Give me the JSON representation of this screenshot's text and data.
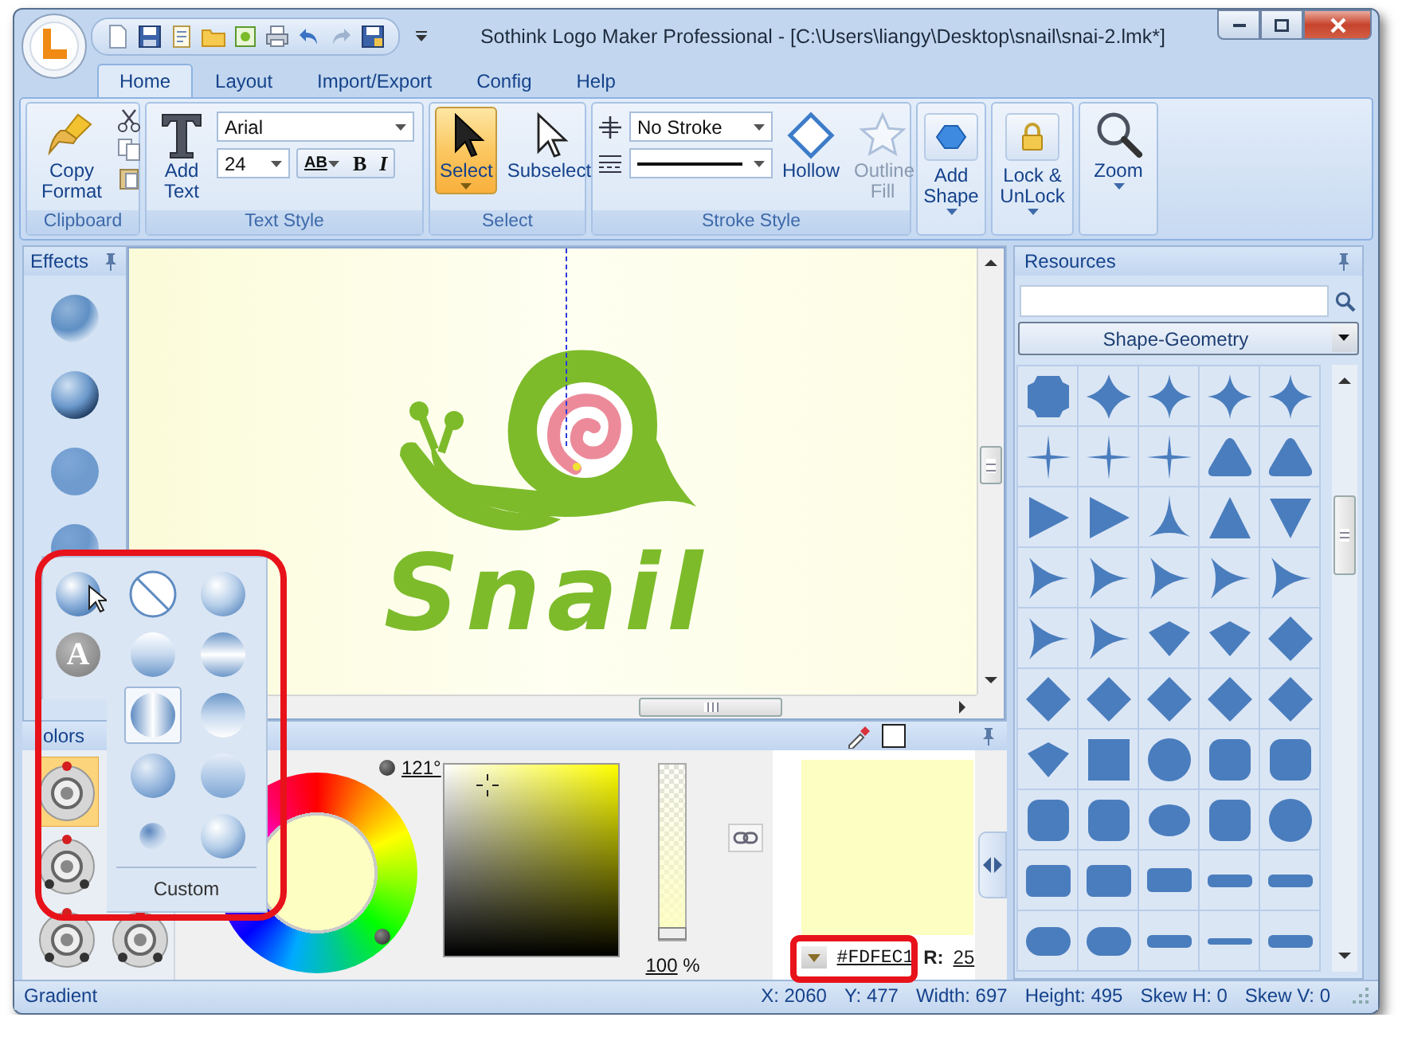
{
  "window": {
    "title": "Sothink Logo Maker Professional - [C:\\Users\\liangy\\Desktop\\snail\\snai-2.lmk*]"
  },
  "tabs": [
    {
      "label": "Home",
      "selected": true
    },
    {
      "label": "Layout",
      "selected": false
    },
    {
      "label": "Import/Export",
      "selected": false
    },
    {
      "label": "Config",
      "selected": false
    },
    {
      "label": "Help",
      "selected": false
    }
  ],
  "ribbon": {
    "clipboard": {
      "label": "Clipboard",
      "copy_format": "Copy Format"
    },
    "text_style": {
      "label": "Text Style",
      "add_text": "Add Text",
      "font": "Arial",
      "size": "24",
      "spacing": "AB",
      "bold": "B",
      "italic": "I"
    },
    "select": {
      "label": "Select",
      "tools": [
        {
          "label": "Select",
          "selected": true
        },
        {
          "label": "Subselect",
          "selected": false
        }
      ]
    },
    "stroke_style": {
      "label": "Stroke Style",
      "stroke": "No Stroke",
      "tools": [
        {
          "label": "Hollow",
          "disabled": false
        },
        {
          "label": "Outline Fill",
          "disabled": true
        }
      ]
    },
    "add_shape": "Add Shape",
    "lock": "Lock & UnLock",
    "zoom": "Zoom"
  },
  "effects": {
    "title": "Effects",
    "items": [
      {
        "kind": "bevel"
      },
      {
        "kind": "emboss"
      },
      {
        "kind": "flat"
      },
      {
        "kind": "shadow"
      }
    ]
  },
  "canvas": {
    "logo_text": "Snail"
  },
  "colors": {
    "title": "olors",
    "presets": [
      {
        "kind": "single",
        "selected": true
      },
      {
        "kind": "triple",
        "selected": false
      },
      {
        "kind": "triple",
        "selected": false
      },
      {
        "kind": "triple",
        "selected": false
      }
    ],
    "hue": "121°",
    "opacity_slider": {
      "level": 1
    },
    "opacity": "100",
    "opacity_unit": "%",
    "hex": "#FDFEC1",
    "r_label": "R:",
    "r_value": "25"
  },
  "resources": {
    "title": "Resources",
    "category": "Shape-Geometry",
    "shapes": [
      {
        "kind": "octagon"
      },
      {
        "kind": "star4-fat"
      },
      {
        "kind": "star4"
      },
      {
        "kind": "star4"
      },
      {
        "kind": "star4"
      },
      {
        "kind": "star4-thin"
      },
      {
        "kind": "star4-thin"
      },
      {
        "kind": "star4-thin"
      },
      {
        "kind": "rtriangle"
      },
      {
        "kind": "rtriangle"
      },
      {
        "kind": "tri-right"
      },
      {
        "kind": "tri-right"
      },
      {
        "kind": "star3"
      },
      {
        "kind": "tri-up"
      },
      {
        "kind": "tri-down"
      },
      {
        "kind": "star3-right"
      },
      {
        "kind": "star3-right"
      },
      {
        "kind": "star3-right"
      },
      {
        "kind": "star3-right"
      },
      {
        "kind": "star3-right"
      },
      {
        "kind": "star3-right"
      },
      {
        "kind": "star3-right"
      },
      {
        "kind": "kite"
      },
      {
        "kind": "kite"
      },
      {
        "kind": "diamond"
      },
      {
        "kind": "diamond"
      },
      {
        "kind": "diamond"
      },
      {
        "kind": "diamond"
      },
      {
        "kind": "diamond"
      },
      {
        "kind": "diamond"
      },
      {
        "kind": "kite"
      },
      {
        "kind": "square"
      },
      {
        "kind": "circle"
      },
      {
        "kind": "rounded"
      },
      {
        "kind": "rounded"
      },
      {
        "kind": "rounded"
      },
      {
        "kind": "rounded"
      },
      {
        "kind": "oval"
      },
      {
        "kind": "rounded"
      },
      {
        "kind": "circle"
      },
      {
        "kind": "rrect"
      },
      {
        "kind": "rrect"
      },
      {
        "kind": "rrect-wide"
      },
      {
        "kind": "bar"
      },
      {
        "kind": "bar"
      },
      {
        "kind": "pill"
      },
      {
        "kind": "pill"
      },
      {
        "kind": "bar"
      },
      {
        "kind": "line"
      },
      {
        "kind": "bar"
      }
    ]
  },
  "popup": {
    "top": [
      {
        "kind": "radial",
        "selected": false
      },
      {
        "kind": "none",
        "selected": false
      },
      {
        "kind": "sphere",
        "selected": false
      }
    ],
    "side": {
      "label": "A"
    },
    "grid": [
      {
        "kind": "linear-down",
        "selected": false
      },
      {
        "kind": "bands",
        "selected": false
      },
      {
        "kind": "cylinder",
        "selected": true
      },
      {
        "kind": "half",
        "selected": false
      },
      {
        "kind": "corner",
        "selected": false
      },
      {
        "kind": "linear-up",
        "selected": false
      },
      {
        "kind": "dot",
        "selected": false
      },
      {
        "kind": "sphere",
        "selected": false
      }
    ],
    "custom": "Custom"
  },
  "status_bar": {
    "mode": "Gradient",
    "fields": [
      "X: 2060",
      "Y: 477",
      "Width: 697",
      "Height: 495",
      "Skew H: 0",
      "Skew V: 0"
    ]
  }
}
